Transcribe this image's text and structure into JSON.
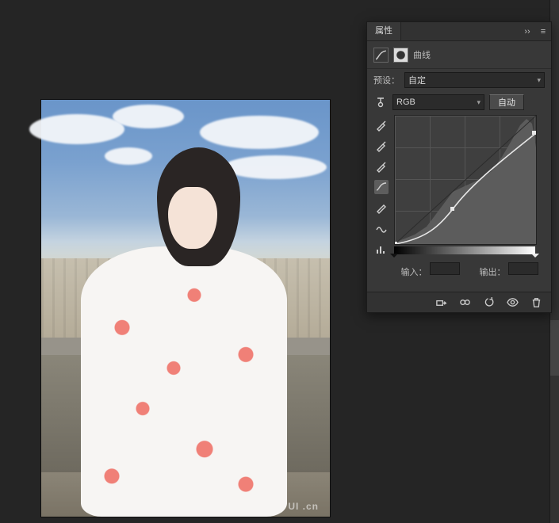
{
  "canvas": {
    "watermark": "UI .cn"
  },
  "panel": {
    "title": "属性",
    "type": "曲线",
    "preset_label": "预设：",
    "preset_value": "自定",
    "channel": "RGB",
    "auto": "自动",
    "input_label": "输入：",
    "output_label": "输出：",
    "input_value": "",
    "output_value": ""
  },
  "chart_data": {
    "type": "line",
    "title": "曲线",
    "xlabel": "输入",
    "ylabel": "输出",
    "xlim": [
      0,
      255
    ],
    "ylim": [
      0,
      255
    ],
    "series": [
      {
        "name": "RGB curve",
        "x": [
          0,
          105,
          255
        ],
        "y": [
          0,
          75,
          225
        ]
      }
    ],
    "baseline": {
      "x": [
        0,
        255
      ],
      "y": [
        0,
        255
      ]
    }
  }
}
